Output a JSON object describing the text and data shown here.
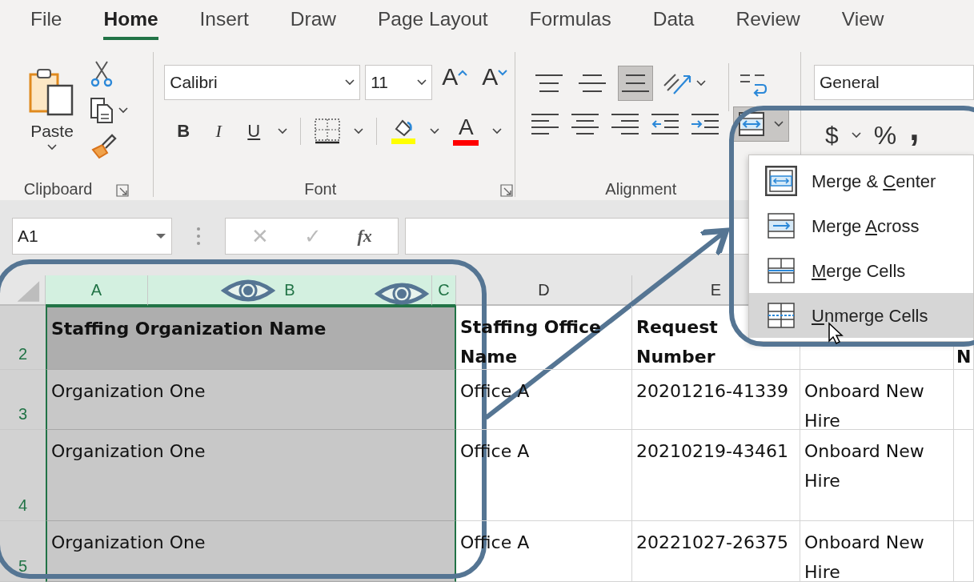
{
  "tabs": [
    {
      "label": "File",
      "selected": false
    },
    {
      "label": "Home",
      "selected": true
    },
    {
      "label": "Insert",
      "selected": false
    },
    {
      "label": "Draw",
      "selected": false
    },
    {
      "label": "Page Layout",
      "selected": false
    },
    {
      "label": "Formulas",
      "selected": false
    },
    {
      "label": "Data",
      "selected": false
    },
    {
      "label": "Review",
      "selected": false
    },
    {
      "label": "View",
      "selected": false
    }
  ],
  "clipboard": {
    "paste": "Paste",
    "group": "Clipboard"
  },
  "font": {
    "name": "Calibri",
    "size": "11",
    "grow": "A",
    "shrink": "A",
    "bold": "B",
    "italic": "I",
    "underline": "U",
    "color_button": "A",
    "group": "Font"
  },
  "alignment": {
    "group": "Alignment",
    "vertical": [
      {
        "selected": false
      },
      {
        "selected": false
      },
      {
        "selected": true
      }
    ],
    "merge_open": true
  },
  "number": {
    "format": "General",
    "currency": "$",
    "percent": "%",
    "comma": ","
  },
  "merge_menu": [
    {
      "kind": "center",
      "before": "Merge & ",
      "key": "C",
      "after": "enter",
      "selected": false
    },
    {
      "kind": "across",
      "before": "Merge ",
      "key": "A",
      "after": "cross",
      "selected": false
    },
    {
      "kind": "cells",
      "key": "M",
      "after": "erge Cells",
      "selected": false
    },
    {
      "kind": "unmerge",
      "key": "U",
      "after": "nmerge Cells",
      "selected": true
    }
  ],
  "name_box": "A1",
  "formula_buttons": {
    "cancel": "✕",
    "enter": "✓",
    "fx": "fx"
  },
  "columns": [
    {
      "label": "A",
      "selected": true
    },
    {
      "label": "B",
      "selected": true
    },
    {
      "label": "C",
      "selected": true
    },
    {
      "label": "D",
      "selected": false
    },
    {
      "label": "E",
      "selected": false
    }
  ],
  "rows": [
    {
      "number": "2",
      "kind": "header",
      "selected": true,
      "org": "Staffing Organization Name",
      "office": "Staffing Office Name",
      "request": "Request Number",
      "col_g": "N"
    },
    {
      "number": "3",
      "kind": "data",
      "selected": true,
      "org": "Organization One",
      "office": "Office A",
      "request": "20201216-41339",
      "type": "Onboard New Hire"
    },
    {
      "number": "4",
      "kind": "data",
      "selected": true,
      "org": "Organization One",
      "office": "Office A",
      "request": "20210219-43461",
      "type": "Onboard New Hire"
    },
    {
      "number": "5",
      "kind": "data",
      "selected": true,
      "org": "Organization One",
      "office": "Office A",
      "request": "20221027-26375",
      "type": "Onboard New Hire"
    }
  ]
}
